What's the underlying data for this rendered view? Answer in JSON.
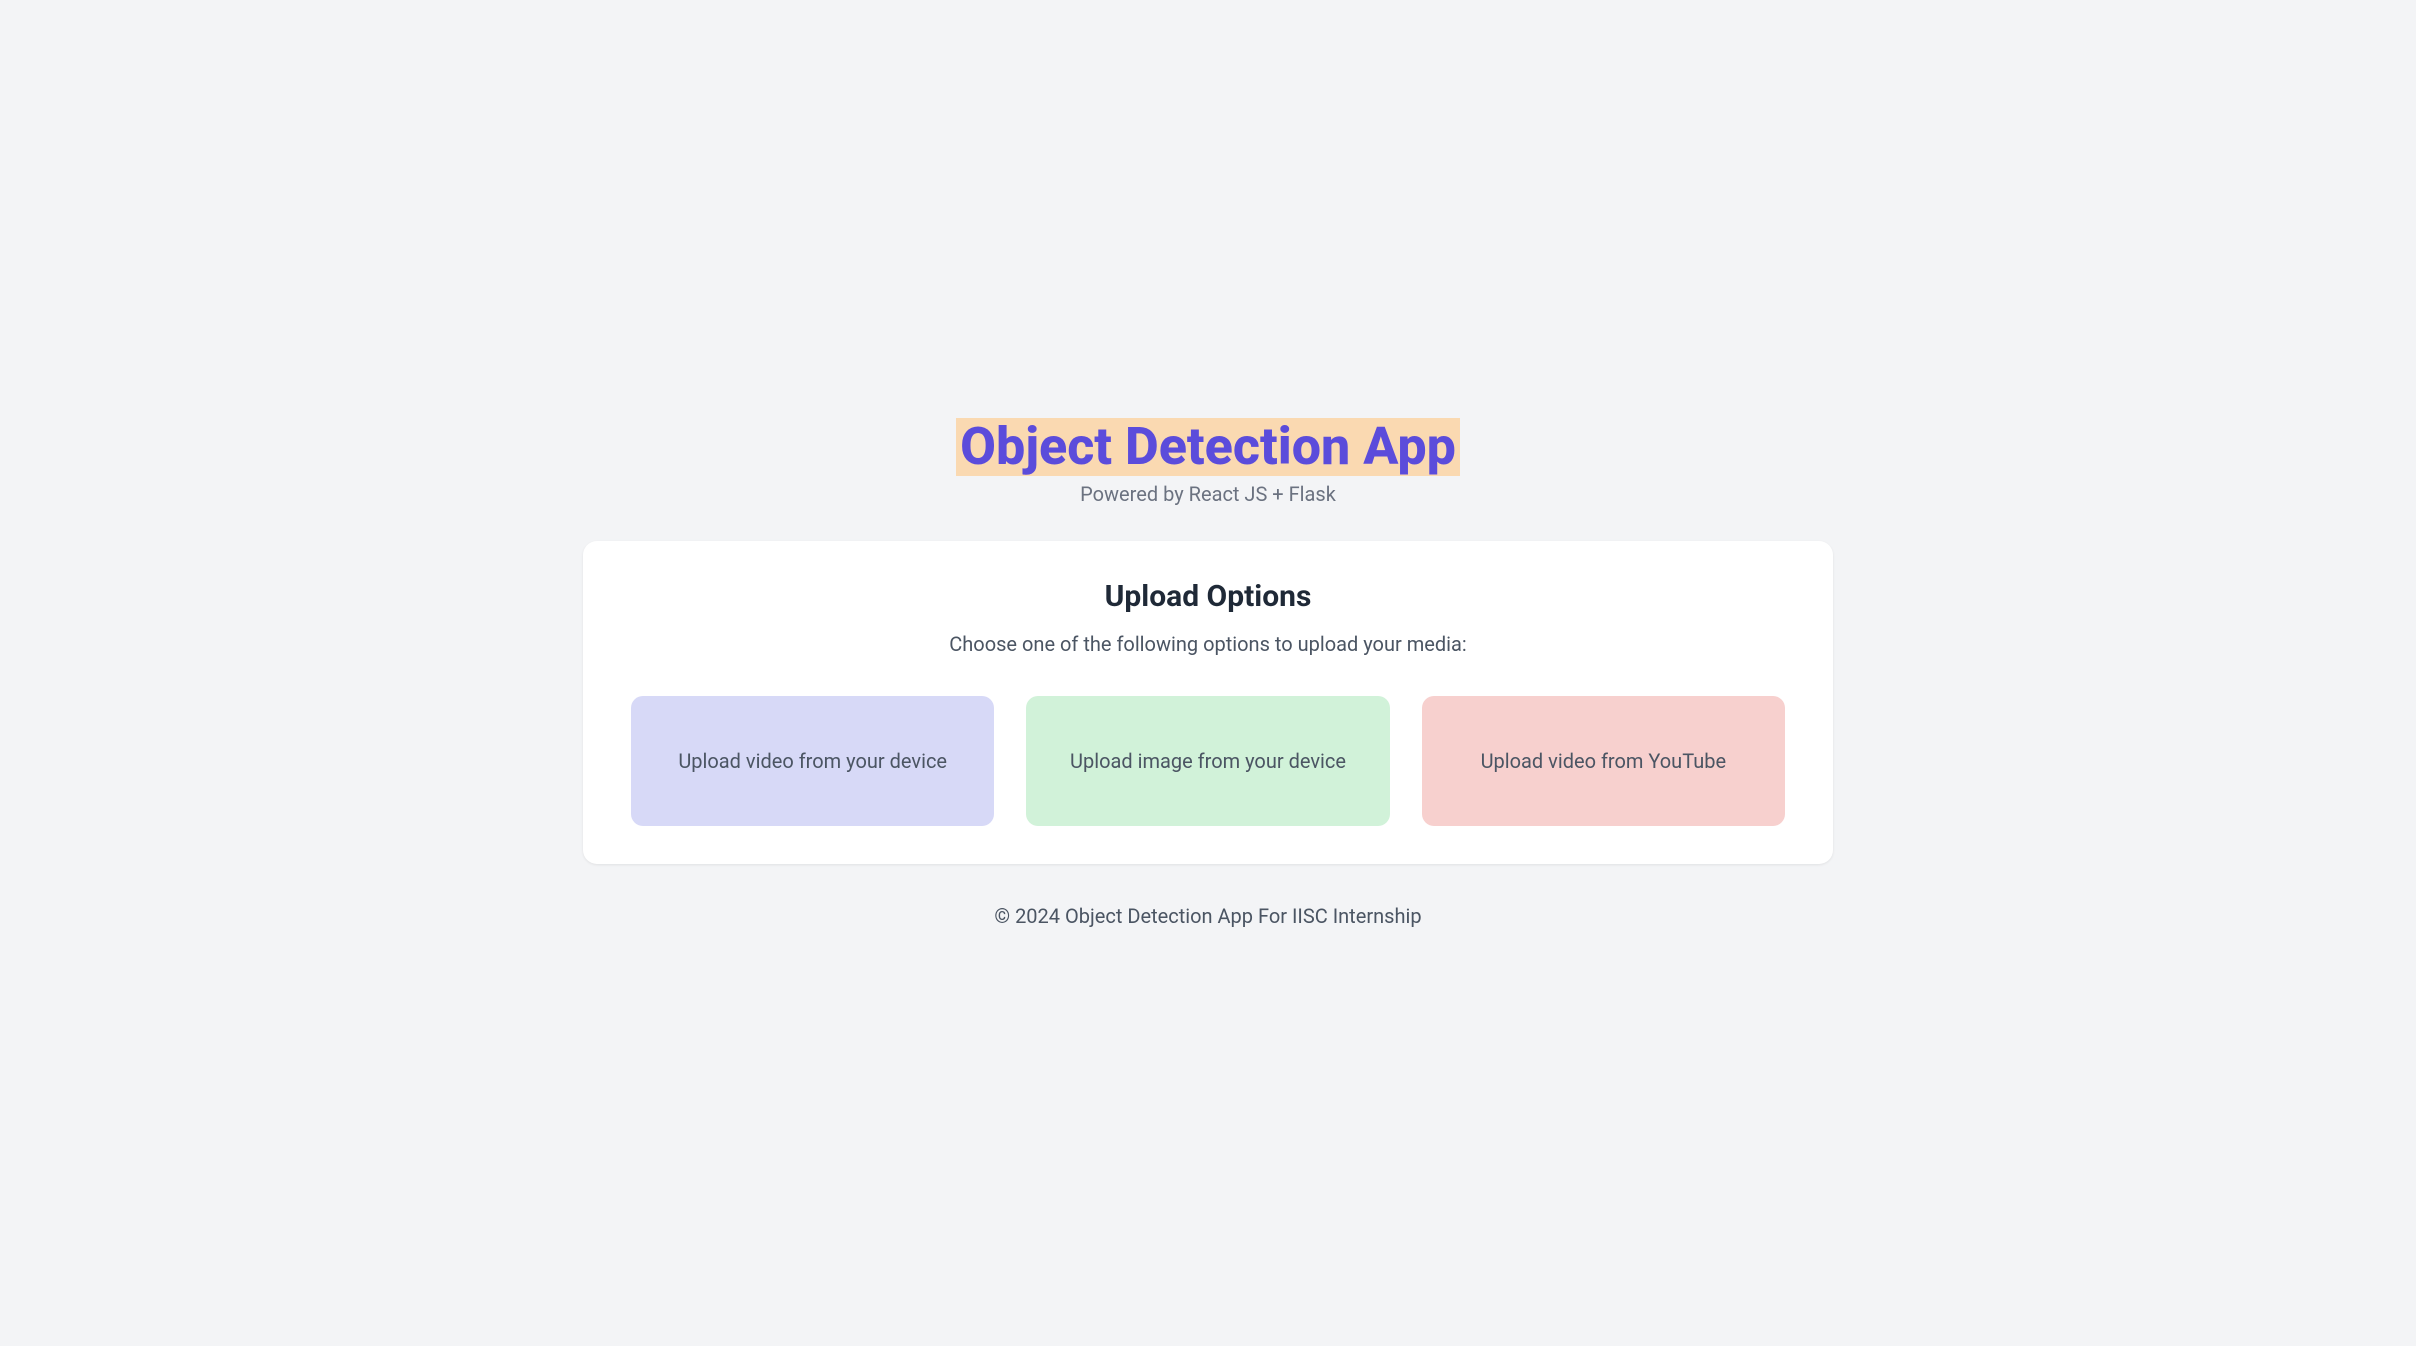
{
  "header": {
    "title": "Object Detection App",
    "subtitle": "Powered by React JS + Flask"
  },
  "card": {
    "title": "Upload Options",
    "description": "Choose one of the following options to upload your media:",
    "options": [
      {
        "label": "Upload video from your device"
      },
      {
        "label": "Upload image from your device"
      },
      {
        "label": "Upload video from YouTube"
      }
    ]
  },
  "footer": {
    "text": "© 2024 Object Detection App For IISC Internship"
  },
  "colors": {
    "title_text": "#5b4cdb",
    "title_highlight": "#fad9b1",
    "option_blue": "#d7d9f7",
    "option_green": "#d1f2d9",
    "option_red": "#f7d0ce"
  }
}
